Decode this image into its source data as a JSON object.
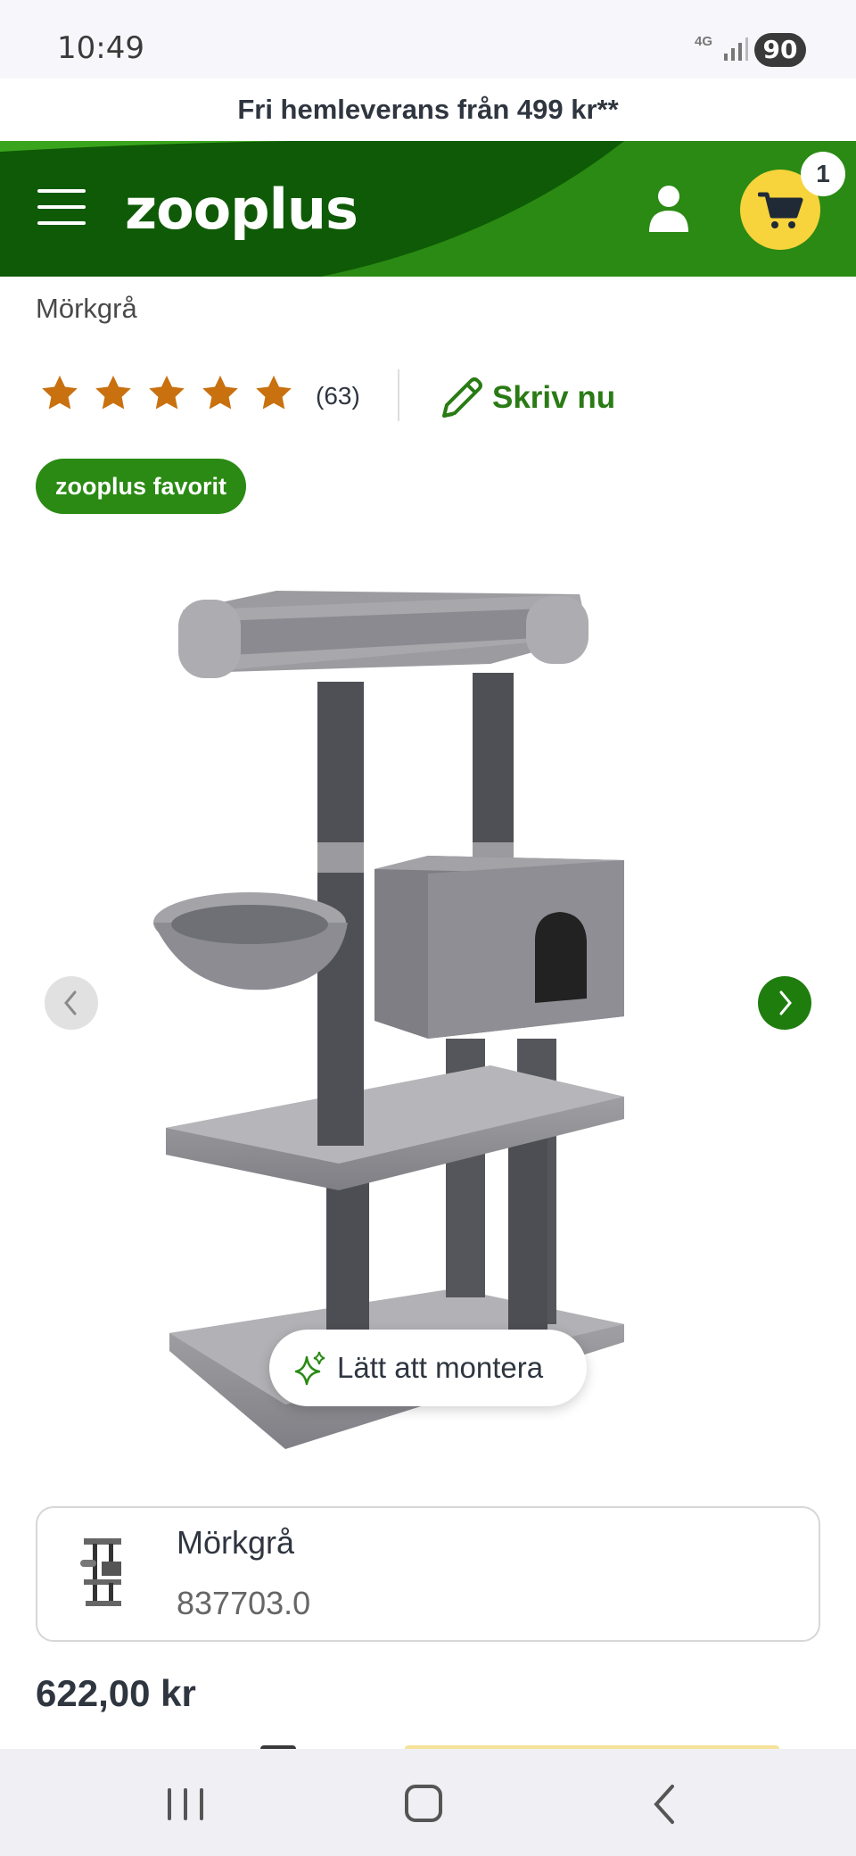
{
  "status_bar": {
    "time": "10:49",
    "network": "4G",
    "battery": "90"
  },
  "promo_banner": "Fri hemleverans från 499 kr**",
  "header": {
    "logo": "zooplus",
    "cart_count": "1"
  },
  "product": {
    "variant_label": "Mörkgrå",
    "rating": 5,
    "review_count": "(63)",
    "write_review": "Skriv nu",
    "badge": "zooplus favorit",
    "feature_pill": "Lätt att montera",
    "selected_variant": {
      "name": "Mörkgrå",
      "sku": "837703.0"
    },
    "price": "622,00 kr"
  },
  "colors": {
    "brand_green": "#2a8a13",
    "dark_green": "#0f5a06",
    "cart_yellow": "#f7d33c",
    "star": "#c9700f"
  },
  "icons": [
    "menu-icon",
    "user-icon",
    "cart-icon",
    "star-icon",
    "pencil-icon",
    "chevron-left-icon",
    "chevron-right-icon",
    "sparkle-icon"
  ]
}
